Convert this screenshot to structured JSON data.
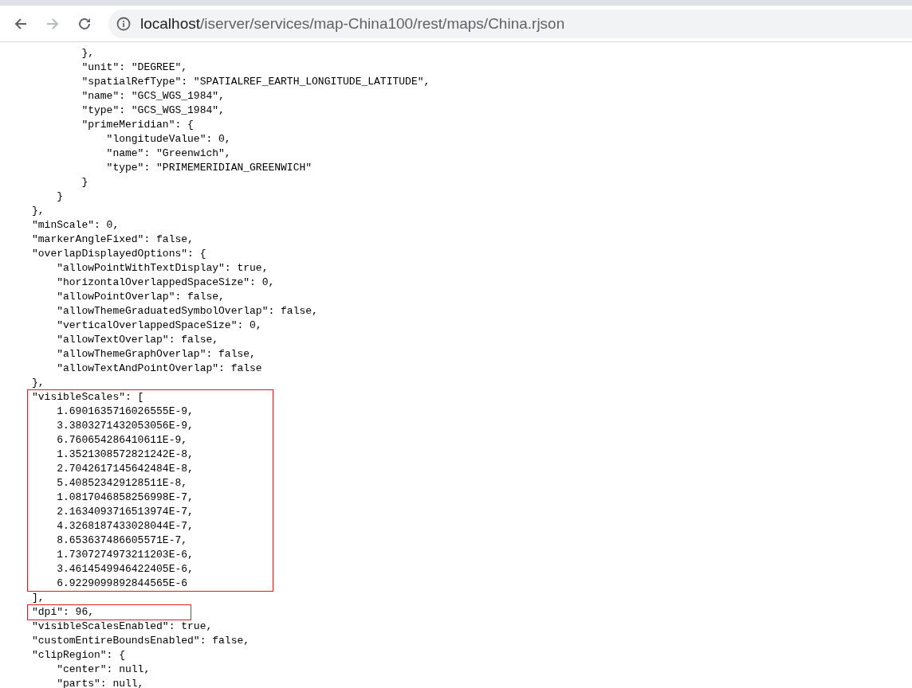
{
  "browser": {
    "back_enabled": true,
    "forward_enabled": false,
    "url_host": "localhost",
    "url_path": "/iserver/services/map-China100/rest/maps/China.rjson"
  },
  "blocks": [
    {
      "highlighted": false,
      "lines": [
        "        },",
        "        \"unit\": \"DEGREE\",",
        "        \"spatialRefType\": \"SPATIALREF_EARTH_LONGITUDE_LATITUDE\",",
        "        \"name\": \"GCS_WGS_1984\",",
        "        \"type\": \"GCS_WGS_1984\",",
        "        \"primeMeridian\": {",
        "            \"longitudeValue\": 0,",
        "            \"name\": \"Greenwich\",",
        "            \"type\": \"PRIMEMERIDIAN_GREENWICH\"",
        "        }",
        "    }",
        "},",
        "\"minScale\": 0,",
        "\"markerAngleFixed\": false,",
        "\"overlapDisplayedOptions\": {",
        "    \"allowPointWithTextDisplay\": true,",
        "    \"horizontalOverlappedSpaceSize\": 0,",
        "    \"allowPointOverlap\": false,",
        "    \"allowThemeGraduatedSymbolOverlap\": false,",
        "    \"verticalOverlappedSpaceSize\": 0,",
        "    \"allowTextOverlap\": false,",
        "    \"allowThemeGraphOverlap\": false,",
        "    \"allowTextAndPointOverlap\": false",
        "},"
      ]
    },
    {
      "highlighted": true,
      "lines": [
        "\"visibleScales\": [",
        "    1.6901635716026555E-9,",
        "    3.3803271432053056E-9,",
        "    6.760654286410611E-9,",
        "    1.3521308572821242E-8,",
        "    2.7042617145642484E-8,",
        "    5.408523429128511E-8,",
        "    1.0817046858256998E-7,",
        "    2.1634093716513974E-7,",
        "    4.3268187433028044E-7,",
        "    8.653637486605571E-7,",
        "    1.7307274973211203E-6,",
        "    3.4614549946422405E-6,",
        "    6.9229099892844565E-6"
      ]
    },
    {
      "highlighted": false,
      "lines": [
        "],"
      ]
    },
    {
      "highlighted": true,
      "lines": [
        "\"dpi\": 96,"
      ]
    },
    {
      "highlighted": false,
      "lines": [
        "\"visibleScalesEnabled\": true,",
        "\"customEntireBoundsEnabled\": false,",
        "\"clipRegion\": {",
        "    \"center\": null,",
        "    \"parts\": null,"
      ]
    }
  ]
}
